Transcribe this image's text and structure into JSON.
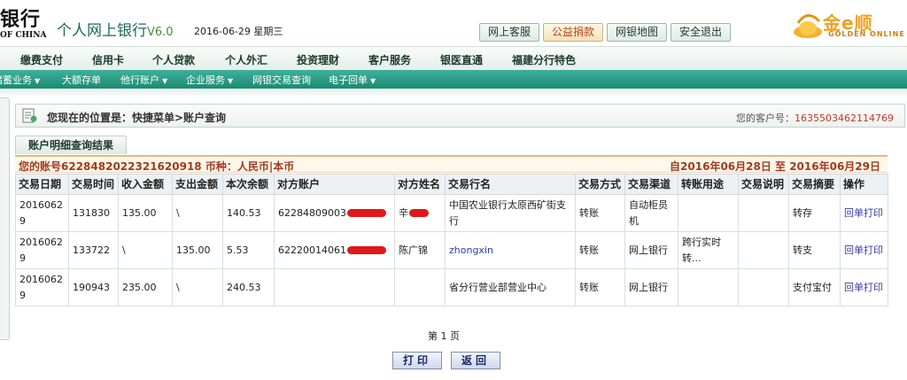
{
  "header": {
    "bank_name": "银行",
    "bank_en": "OF CHINA",
    "site_title": "个人网上银行",
    "site_version": "V6.0",
    "date": "2016-06-29 星期三",
    "buttons": [
      "网上客服",
      "公益捐款",
      "网银地图",
      "安全退出"
    ],
    "partner_logo": {
      "text": "金e顺",
      "sub": "GOLDEN ONLINE",
      "color": "#f2a01c"
    }
  },
  "main_nav": [
    "缴费支付",
    "信用卡",
    "个人贷款",
    "个人外汇",
    "投资理财",
    "客户服务",
    "银医直通",
    "福建分行特色"
  ],
  "sub_nav": [
    "储蓄业务",
    "大额存单",
    "他行账户",
    "企业服务",
    "网银交易查询",
    "电子回单"
  ],
  "location": {
    "text": "您现在的位置是：快捷菜单>账户查询",
    "customer_label": "您的客户号：",
    "customer_no": "1635503462114769"
  },
  "tab_title": "账户明细查询结果",
  "account_bar": {
    "info": "您的账号6228482022321620918 币种：人民币|本币",
    "date_range": "自2016年06月28日  至  2016年06月29日"
  },
  "table": {
    "headers": [
      "交易日期",
      "交易时间",
      "收入金额",
      "支出金额",
      "本次余额",
      "对方账户",
      "对方姓名",
      "交易行名",
      "交易方式",
      "交易渠道",
      "转账用途",
      "交易说明",
      "交易摘要",
      "操作"
    ],
    "rows": [
      {
        "date": "20160629",
        "time": "131830",
        "income": "135.00",
        "expense": "\\",
        "balance": "140.53",
        "account": "62284809003",
        "name": "辛",
        "bank": "中国农业银行太原西矿街支行",
        "method": "转账",
        "channel": "自动柜员机",
        "purpose": "",
        "note": "",
        "summary": "转存",
        "op": "回单打印"
      },
      {
        "date": "20160629",
        "time": "133722",
        "income": "\\",
        "expense": "135.00",
        "balance": "5.53",
        "account": "62220014061",
        "name": "陈广锦",
        "bank": "zhongxin",
        "method": "转账",
        "channel": "网上银行",
        "purpose": "跨行实时转...",
        "note": "",
        "summary": "转支",
        "op": "回单打印"
      },
      {
        "date": "20160629",
        "time": "190943",
        "income": "235.00",
        "expense": "\\",
        "balance": "240.53",
        "account": "",
        "name": "",
        "bank": "省分行营业部营业中心",
        "method": "转账",
        "channel": "网上银行",
        "purpose": "",
        "note": "",
        "summary": "支付宝付",
        "op": "回单打印"
      }
    ]
  },
  "pagination": "第 1 页",
  "actions": {
    "print": "打印",
    "back": "返回"
  }
}
